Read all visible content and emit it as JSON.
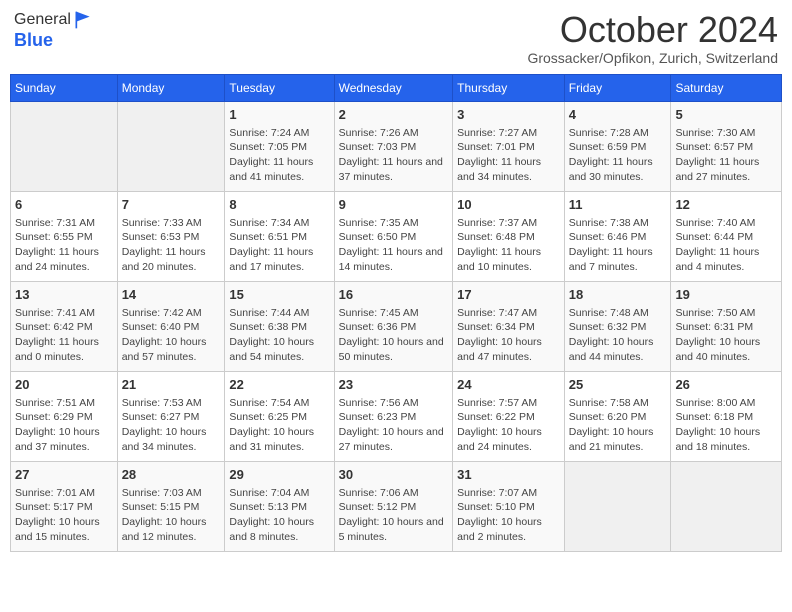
{
  "header": {
    "logo_line1": "General",
    "logo_line2": "Blue",
    "month": "October 2024",
    "location": "Grossacker/Opfikon, Zurich, Switzerland"
  },
  "days_of_week": [
    "Sunday",
    "Monday",
    "Tuesday",
    "Wednesday",
    "Thursday",
    "Friday",
    "Saturday"
  ],
  "weeks": [
    [
      {
        "day": "",
        "content": ""
      },
      {
        "day": "",
        "content": ""
      },
      {
        "day": "1",
        "content": "Sunrise: 7:24 AM\nSunset: 7:05 PM\nDaylight: 11 hours and 41 minutes."
      },
      {
        "day": "2",
        "content": "Sunrise: 7:26 AM\nSunset: 7:03 PM\nDaylight: 11 hours and 37 minutes."
      },
      {
        "day": "3",
        "content": "Sunrise: 7:27 AM\nSunset: 7:01 PM\nDaylight: 11 hours and 34 minutes."
      },
      {
        "day": "4",
        "content": "Sunrise: 7:28 AM\nSunset: 6:59 PM\nDaylight: 11 hours and 30 minutes."
      },
      {
        "day": "5",
        "content": "Sunrise: 7:30 AM\nSunset: 6:57 PM\nDaylight: 11 hours and 27 minutes."
      }
    ],
    [
      {
        "day": "6",
        "content": "Sunrise: 7:31 AM\nSunset: 6:55 PM\nDaylight: 11 hours and 24 minutes."
      },
      {
        "day": "7",
        "content": "Sunrise: 7:33 AM\nSunset: 6:53 PM\nDaylight: 11 hours and 20 minutes."
      },
      {
        "day": "8",
        "content": "Sunrise: 7:34 AM\nSunset: 6:51 PM\nDaylight: 11 hours and 17 minutes."
      },
      {
        "day": "9",
        "content": "Sunrise: 7:35 AM\nSunset: 6:50 PM\nDaylight: 11 hours and 14 minutes."
      },
      {
        "day": "10",
        "content": "Sunrise: 7:37 AM\nSunset: 6:48 PM\nDaylight: 11 hours and 10 minutes."
      },
      {
        "day": "11",
        "content": "Sunrise: 7:38 AM\nSunset: 6:46 PM\nDaylight: 11 hours and 7 minutes."
      },
      {
        "day": "12",
        "content": "Sunrise: 7:40 AM\nSunset: 6:44 PM\nDaylight: 11 hours and 4 minutes."
      }
    ],
    [
      {
        "day": "13",
        "content": "Sunrise: 7:41 AM\nSunset: 6:42 PM\nDaylight: 11 hours and 0 minutes."
      },
      {
        "day": "14",
        "content": "Sunrise: 7:42 AM\nSunset: 6:40 PM\nDaylight: 10 hours and 57 minutes."
      },
      {
        "day": "15",
        "content": "Sunrise: 7:44 AM\nSunset: 6:38 PM\nDaylight: 10 hours and 54 minutes."
      },
      {
        "day": "16",
        "content": "Sunrise: 7:45 AM\nSunset: 6:36 PM\nDaylight: 10 hours and 50 minutes."
      },
      {
        "day": "17",
        "content": "Sunrise: 7:47 AM\nSunset: 6:34 PM\nDaylight: 10 hours and 47 minutes."
      },
      {
        "day": "18",
        "content": "Sunrise: 7:48 AM\nSunset: 6:32 PM\nDaylight: 10 hours and 44 minutes."
      },
      {
        "day": "19",
        "content": "Sunrise: 7:50 AM\nSunset: 6:31 PM\nDaylight: 10 hours and 40 minutes."
      }
    ],
    [
      {
        "day": "20",
        "content": "Sunrise: 7:51 AM\nSunset: 6:29 PM\nDaylight: 10 hours and 37 minutes."
      },
      {
        "day": "21",
        "content": "Sunrise: 7:53 AM\nSunset: 6:27 PM\nDaylight: 10 hours and 34 minutes."
      },
      {
        "day": "22",
        "content": "Sunrise: 7:54 AM\nSunset: 6:25 PM\nDaylight: 10 hours and 31 minutes."
      },
      {
        "day": "23",
        "content": "Sunrise: 7:56 AM\nSunset: 6:23 PM\nDaylight: 10 hours and 27 minutes."
      },
      {
        "day": "24",
        "content": "Sunrise: 7:57 AM\nSunset: 6:22 PM\nDaylight: 10 hours and 24 minutes."
      },
      {
        "day": "25",
        "content": "Sunrise: 7:58 AM\nSunset: 6:20 PM\nDaylight: 10 hours and 21 minutes."
      },
      {
        "day": "26",
        "content": "Sunrise: 8:00 AM\nSunset: 6:18 PM\nDaylight: 10 hours and 18 minutes."
      }
    ],
    [
      {
        "day": "27",
        "content": "Sunrise: 7:01 AM\nSunset: 5:17 PM\nDaylight: 10 hours and 15 minutes."
      },
      {
        "day": "28",
        "content": "Sunrise: 7:03 AM\nSunset: 5:15 PM\nDaylight: 10 hours and 12 minutes."
      },
      {
        "day": "29",
        "content": "Sunrise: 7:04 AM\nSunset: 5:13 PM\nDaylight: 10 hours and 8 minutes."
      },
      {
        "day": "30",
        "content": "Sunrise: 7:06 AM\nSunset: 5:12 PM\nDaylight: 10 hours and 5 minutes."
      },
      {
        "day": "31",
        "content": "Sunrise: 7:07 AM\nSunset: 5:10 PM\nDaylight: 10 hours and 2 minutes."
      },
      {
        "day": "",
        "content": ""
      },
      {
        "day": "",
        "content": ""
      }
    ]
  ]
}
